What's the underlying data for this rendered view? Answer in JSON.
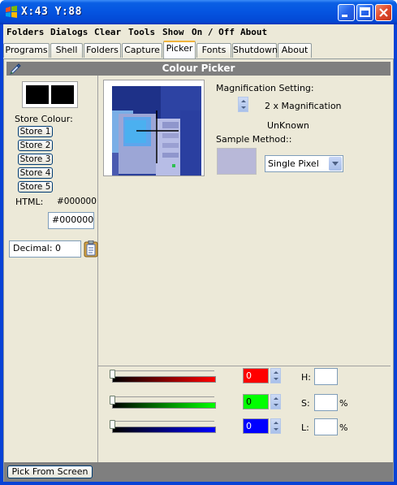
{
  "window": {
    "title": "X:43  Y:88"
  },
  "menu": {
    "items": [
      "Folders",
      "Dialogs",
      "Clear",
      "Tools",
      "Show",
      "On / Off",
      "About"
    ]
  },
  "tabs": [
    "Programs",
    "Shell",
    "Folders",
    "Capture",
    "Picker",
    "Fonts",
    "Shutdown",
    "About"
  ],
  "active_tab": "Picker",
  "picker": {
    "header": "Colour Picker",
    "store_colour_label": "Store Colour:",
    "store_buttons": [
      "Store 1",
      "Store 2",
      "Store 3",
      "Store 4",
      "Store 5"
    ],
    "html_label": "HTML:",
    "html_value": "#000000",
    "html_field_value": "#000000",
    "decimal_field_value": "Decimal: 0",
    "magnification_label": "Magnification Setting:",
    "magnification_value": "2 x Magnification",
    "unknown_label": "UnKnown",
    "sample_method_label": "Sample Method::",
    "sample_method_selected": "Single Pixel",
    "sample_colour": "#b8b8d8",
    "rgb": [
      {
        "channel": "red",
        "value": "0",
        "color": "#ff0000"
      },
      {
        "channel": "green",
        "value": "0",
        "color": "#00ff00"
      },
      {
        "channel": "blue",
        "value": "0",
        "color": "#0000ff"
      }
    ],
    "hsl_labels": {
      "h": "H:",
      "s": "S:",
      "l": "L:"
    },
    "percent": "%",
    "pick_button": "Pick From Screen"
  },
  "icons": {
    "app": "app-icon",
    "eyedropper": "eyedropper-icon",
    "clipboard": "clipboard-icon"
  },
  "colors": {
    "titlebar": "#0554e0",
    "header_bg": "#7f7f7f",
    "swatch": "#000000"
  }
}
